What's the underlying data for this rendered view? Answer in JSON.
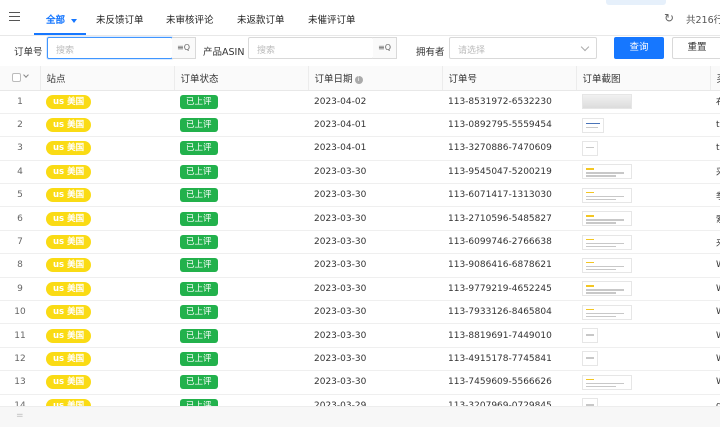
{
  "tabs": [
    {
      "label": "全部",
      "active": true
    },
    {
      "label": "未反馈订单",
      "active": false
    },
    {
      "label": "未审核评论",
      "active": false
    },
    {
      "label": "未返款订单",
      "active": false
    },
    {
      "label": "未催评订单",
      "active": false
    }
  ],
  "header": {
    "total": "共216行"
  },
  "filters": {
    "order_label": "订单号",
    "order_placeholder": "搜索",
    "asin_label": "产品ASIN",
    "asin_placeholder": "搜索",
    "owner_label": "拥有者",
    "owner_placeholder": "请选择",
    "search_button": "查询",
    "reset_button": "重置"
  },
  "columns": {
    "site": "站点",
    "status": "订单状态",
    "date": "订单日期",
    "order_no": "订单号",
    "screenshot": "订单截图",
    "extra": "买"
  },
  "rows": [
    {
      "idx": "1",
      "site": "us 美国",
      "status": "已上评",
      "date": "2023-04-02",
      "order": "113-8531972-6532230",
      "thumb": "grey",
      "extra": "布"
    },
    {
      "idx": "2",
      "site": "us 美国",
      "status": "已上评",
      "date": "2023-04-01",
      "order": "113-0892795-5559454",
      "thumb": "med",
      "extra": "tc"
    },
    {
      "idx": "3",
      "site": "us 美国",
      "status": "已上评",
      "date": "2023-04-01",
      "order": "113-3270886-7470609",
      "thumb": "small",
      "extra": "tc"
    },
    {
      "idx": "4",
      "site": "us 美国",
      "status": "已上评",
      "date": "2023-03-30",
      "order": "113-9545047-5200219",
      "thumb": "wide",
      "extra": "采"
    },
    {
      "idx": "5",
      "site": "us 美国",
      "status": "已上评",
      "date": "2023-03-30",
      "order": "113-6071417-1313030",
      "thumb": "wide",
      "extra": "季"
    },
    {
      "idx": "6",
      "site": "us 美国",
      "status": "已上评",
      "date": "2023-03-30",
      "order": "113-2710596-5485827",
      "thumb": "wide",
      "extra": "索"
    },
    {
      "idx": "7",
      "site": "us 美国",
      "status": "已上评",
      "date": "2023-03-30",
      "order": "113-6099746-2766638",
      "thumb": "wide",
      "extra": "来"
    },
    {
      "idx": "8",
      "site": "us 美国",
      "status": "已上评",
      "date": "2023-03-30",
      "order": "113-9086416-6878621",
      "thumb": "wide",
      "extra": "W"
    },
    {
      "idx": "9",
      "site": "us 美国",
      "status": "已上评",
      "date": "2023-03-30",
      "order": "113-9779219-4652245",
      "thumb": "wide",
      "extra": "W"
    },
    {
      "idx": "10",
      "site": "us 美国",
      "status": "已上评",
      "date": "2023-03-30",
      "order": "113-7933126-8465804",
      "thumb": "wide",
      "extra": "W"
    },
    {
      "idx": "11",
      "site": "us 美国",
      "status": "已上评",
      "date": "2023-03-30",
      "order": "113-8819691-7449010",
      "thumb": "small",
      "extra": "W"
    },
    {
      "idx": "12",
      "site": "us 美国",
      "status": "已上评",
      "date": "2023-03-30",
      "order": "113-4915178-7745841",
      "thumb": "small",
      "extra": "W"
    },
    {
      "idx": "13",
      "site": "us 美国",
      "status": "已上评",
      "date": "2023-03-30",
      "order": "113-7459609-5566626",
      "thumb": "wide",
      "extra": "W"
    },
    {
      "idx": "14",
      "site": "us 美国",
      "status": "已上评",
      "date": "2023-03-29",
      "order": "113-3207969-0729845",
      "thumb": "small",
      "extra": "d"
    }
  ]
}
